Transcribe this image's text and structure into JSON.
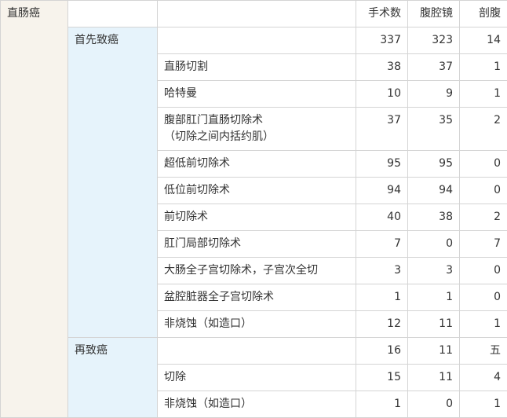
{
  "table": {
    "category": "直肠癌",
    "headers": [
      "手术数",
      "腹腔镜",
      "剖腹"
    ],
    "groups": [
      {
        "label": "首先致癌",
        "summary": [
          "337",
          "323",
          "14"
        ],
        "rows": [
          {
            "name": [
              "直肠切割"
            ],
            "values": [
              "38",
              "37",
              "1"
            ]
          },
          {
            "name": [
              "哈特曼"
            ],
            "values": [
              "10",
              "9",
              "1"
            ]
          },
          {
            "name": [
              "腹部肛门直肠切除术",
              "（切除之间内括约肌）"
            ],
            "values": [
              "37",
              "35",
              "2"
            ]
          },
          {
            "name": [
              "超低前切除术"
            ],
            "values": [
              "95",
              "95",
              "0"
            ]
          },
          {
            "name": [
              "低位前切除术"
            ],
            "values": [
              "94",
              "94",
              "0"
            ]
          },
          {
            "name": [
              "前切除术"
            ],
            "values": [
              "40",
              "38",
              "2"
            ]
          },
          {
            "name": [
              "肛门局部切除术"
            ],
            "values": [
              "7",
              "0",
              "7"
            ]
          },
          {
            "name": [
              "大肠全子宫切除术，子宫次全切"
            ],
            "values": [
              "3",
              "3",
              "0"
            ]
          },
          {
            "name": [
              "盆腔脏器全子宫切除术"
            ],
            "values": [
              "1",
              "1",
              "0"
            ]
          },
          {
            "name": [
              "非烧蚀（如造口）"
            ],
            "values": [
              "12",
              "11",
              "1"
            ]
          }
        ]
      },
      {
        "label": "再致癌",
        "summary": [
          "16",
          "11",
          "五"
        ],
        "rows": [
          {
            "name": [
              "切除"
            ],
            "values": [
              "15",
              "11",
              "4"
            ]
          },
          {
            "name": [
              "非烧蚀（如造口）"
            ],
            "values": [
              "1",
              "0",
              "1"
            ]
          }
        ]
      }
    ]
  }
}
